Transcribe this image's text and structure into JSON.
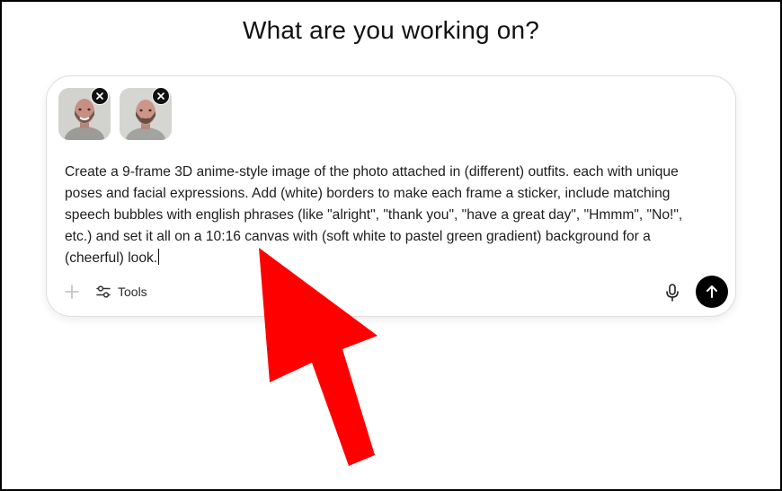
{
  "header": {
    "title": "What are you working on?"
  },
  "attachments": [
    {
      "icon": "photo-thumbnail",
      "remove_icon": "close-icon"
    },
    {
      "icon": "photo-thumbnail",
      "remove_icon": "close-icon"
    }
  ],
  "composer": {
    "prompt_text": "Create a 9-frame 3D anime-style image of the photo attached in (different) outfits. each with unique\nposes and facial expressions. Add (white) borders to make each frame a sticker, include matching\nspeech bubbles with english phrases (like \"alright\", \"thank you\", \"have a great day\", \"Hmmm\", \"No!\",\netc.) and set it all on a 10:16 canvas with (soft white to pastel green gradient) background for a\n(cheerful) look.",
    "tools_label": "Tools"
  },
  "icons": {
    "plus": "plus-icon",
    "tools": "sliders-icon",
    "mic": "microphone-icon",
    "send": "arrow-up-icon",
    "pointer": "red-arrow-pointer"
  },
  "colors": {
    "send_button": "#000000",
    "pointer": "#ff0000"
  }
}
